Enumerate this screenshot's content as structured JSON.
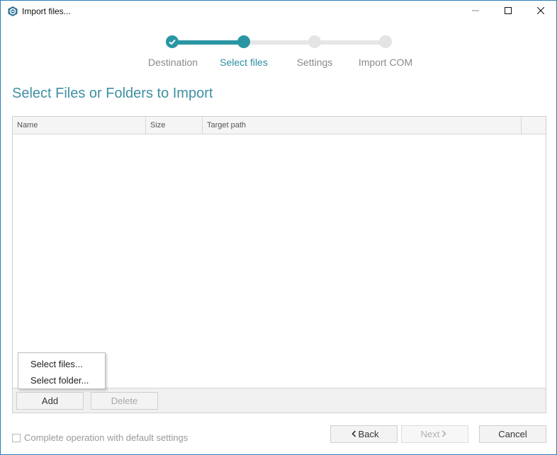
{
  "window": {
    "title": "Import files..."
  },
  "stepper": {
    "steps": [
      {
        "label": "Destination",
        "state": "done"
      },
      {
        "label": "Select files",
        "state": "active"
      },
      {
        "label": "Settings",
        "state": "pending"
      },
      {
        "label": "Import COM",
        "state": "pending"
      }
    ],
    "colors": {
      "accent": "#2a95a3",
      "pending": "#e6e6e6"
    }
  },
  "page": {
    "title": "Select Files or Folders to Import"
  },
  "table": {
    "columns": [
      "Name",
      "Size",
      "Target path"
    ],
    "rows": []
  },
  "context_menu": {
    "items": [
      "Select files...",
      "Select folder..."
    ]
  },
  "table_footer": {
    "add_label": "Add",
    "delete_label": "Delete"
  },
  "bottom": {
    "default_settings_label": "Complete operation with default settings",
    "back_label": "Back",
    "next_label": "Next",
    "cancel_label": "Cancel"
  }
}
